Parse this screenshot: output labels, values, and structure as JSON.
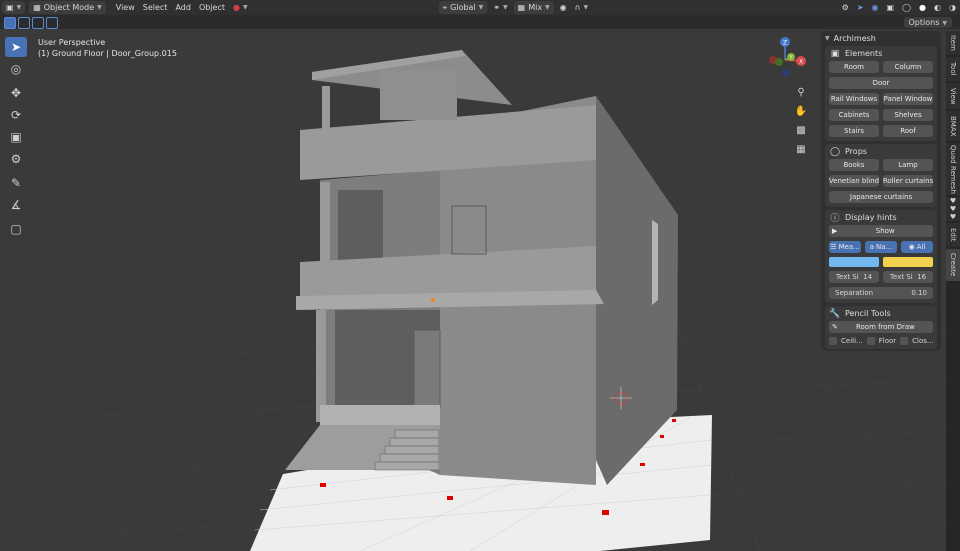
{
  "header": {
    "editor_icon": "3d-viewport-icon",
    "mode": "Object Mode",
    "menus": [
      "View",
      "Select",
      "Add",
      "Object"
    ],
    "orientation": "Global",
    "pivot": "Mix",
    "options_label": "Options"
  },
  "viewport": {
    "perspective": "User Perspective",
    "object_info": "(1) Ground Floor | Door_Group.015",
    "gizmo_axes": [
      "Z",
      "Y",
      "X"
    ]
  },
  "tabs": [
    "Item",
    "Tool",
    "View",
    "BMAX",
    "Quad Remesh",
    "♥♥♥",
    "Edit",
    "Create"
  ],
  "active_tab": "Create",
  "panel": {
    "title": "Archimesh",
    "elements": {
      "title": "Elements",
      "buttons": [
        "Room",
        "Column",
        "Door",
        "Rail Windows",
        "Panel Window",
        "Cabinets",
        "Shelves",
        "Stairs",
        "Roof"
      ]
    },
    "props": {
      "title": "Props",
      "buttons": [
        "Books",
        "Lamp",
        "Venetian blind",
        "Roller curtains",
        "Japanese curtains"
      ]
    },
    "display_hints": {
      "title": "Display hints",
      "show_label": "Show",
      "toggles": [
        "Mea...",
        "Na...",
        "All"
      ],
      "swatch_colors": [
        "#71b8f0",
        "#f0d24e"
      ],
      "text_size_1": {
        "label": "Text Si",
        "value": "14"
      },
      "text_size_2": {
        "label": "Text Si",
        "value": "16"
      },
      "separation": {
        "label": "Separation",
        "value": "0.10"
      }
    },
    "pencil_tools": {
      "title": "Pencil Tools",
      "room_from_draw": "Room from Draw",
      "checks": [
        "Ceili...",
        "Floor",
        "Clos..."
      ]
    }
  }
}
